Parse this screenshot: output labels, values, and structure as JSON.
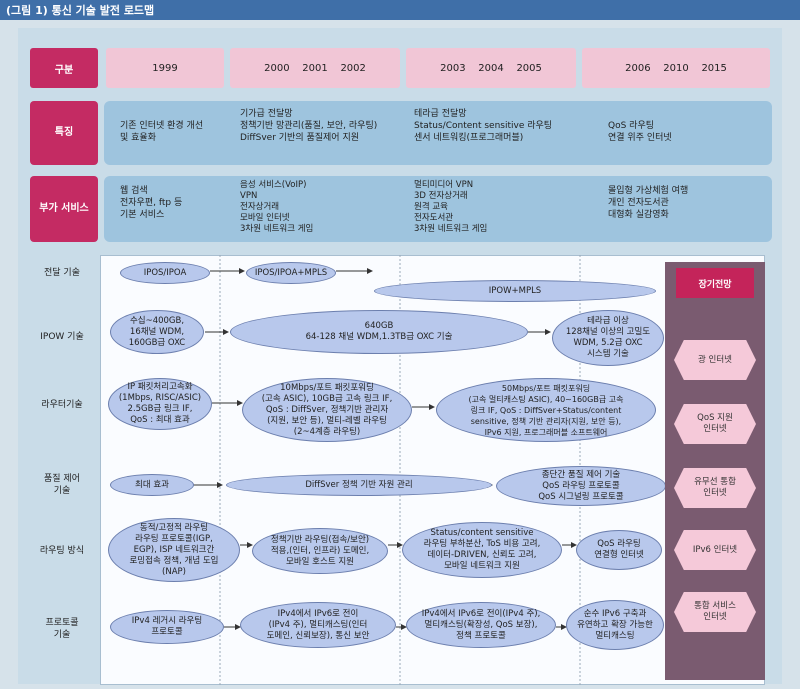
{
  "title": "(그림 1) 통신 기술 발전 로드맵",
  "header": {
    "label": "구분",
    "years": [
      {
        "text": "1999"
      },
      {
        "text": "2000    2001    2002"
      },
      {
        "text": "2003    2004    2005"
      },
      {
        "text": "2006    2010    2015"
      }
    ]
  },
  "rows": {
    "features": {
      "label": "특징",
      "cols": [
        "기존 인터넷 환경 개선\n및 효율화",
        "기가급 전달망\n정책기반 망관리(품질, 보안, 라우팅)\nDiffSver 기반의 품질제어 지원",
        "테라급 전달망\nStatus/Content sensitive 라우팅\n센서 네트워킹(프로그래머블)",
        "QoS 라우팅\n연결 위주 인터넷"
      ]
    },
    "services": {
      "label": "부가 서비스",
      "cols": [
        "웹 검색\n전자우편, ftp 등\n기본 서비스",
        "음성 서비스(VoIP)\nVPN\n전자상거래\n모바일 인터넷\n3차원 네트워크 게임",
        "멀티미디어 VPN\n3D 전자상거래\n원격 교육\n전자도서관\n3차원 네트워크 게임",
        "몰입형 가상체험 여행\n개인 전자도서관\n대형화 실감영화"
      ]
    }
  },
  "tech_rows": [
    {
      "label": "전달 기술"
    },
    {
      "label": "IPOW 기술"
    },
    {
      "label": "라우터기술"
    },
    {
      "label": "품질 제어\n기술"
    },
    {
      "label": "라우팅 방식"
    },
    {
      "label": "프로토콜\n기술"
    }
  ],
  "ellipses": {
    "e_ipos": "IPOS/IPOA",
    "e_mpls": "IPOS/IPOA+MPLS",
    "e_ipow": "IPOW+MPLS",
    "e_ipow1": "수십~400GB,\n16채널 WDM,\n160GB급 OXC",
    "e_ipow2": "640GB\n64-128 채널 WDM,1.3TB급 OXC 기술",
    "e_ipow3": "테라급 이상\n128채널 이상의 고밀도\nWDM, 5.2급 OXC\n시스템 기술",
    "e_rt1": "IP 패킷처리고속화\n(1Mbps, RISC/ASIC)\n2.5GB급 링크 IF,\nQoS : 최대 효과",
    "e_rt2": "10Mbps/포트 패킷포워딩\n(고속 ASIC), 10GB급 고속 링크 IF,\nQoS : DiffSver, 정책기반 관리자\n(지원, 보안 등), 멀티-레벨 라우팅\n(2~4계층 라우팅)",
    "e_rt3": "50Mbps/포트 패킷포워딩\n(고속 멀티캐스팅 ASIC), 40~160GB급 고속\n링크 IF, QoS : DiffSver+Status/content\nsensitive, 정책 기반 관리자(지원, 보안 등),\nIPv6 지원, 프로그래머블 소프트웨어",
    "e_q1": "최대 효과",
    "e_q2": "DiffSver 정책 기반 자원 관리",
    "e_q3": "종단간 품질 제어 기술\nQoS 라우팅 프로토콜\nQoS 시그널링 프로토콜",
    "e_r1": "동적/고정적 라우팅\n라우팅 프로토콜(IGP,\nEGP), ISP 네트워크간\n로밍접속 정책, 개념 도입\n(NAP)",
    "e_r2": "정책기반 라우팅(접속/보안)\n적용,(인터, 인프라) 도메인,\n모바일 호스트 지원",
    "e_r3": "Status/content sensitive\n라우팅 부하분산, ToS 비용 고려,\n데이터-DRIVEN, 신뢰도 고려,\n모바일 네트워크 지원",
    "e_r4": "QoS 라우팅\n연결형 인터넷",
    "e_p1": "IPv4 레거시 라우팅\n프로토콜",
    "e_p2": "IPv4에서 IPv6로 전이\n(IPv4 주), 멀티캐스팅(인터\n도메인, 신뢰보장), 통신 보안",
    "e_p3": "IPv4에서 IPv6로 전이(IPv4 주),\n멀티캐스팅(확장성, QoS 보장),\n정책 프로토콜",
    "e_p4": "순수 IPv6 구축과\n유연하고 확장 가능한\n멀티캐스팅"
  },
  "outlook": {
    "header": "장기전망",
    "items": [
      "광 인터넷",
      "QoS 지원\n인터넷",
      "유무선 통합\n인터넷",
      "IPv6 인터넷",
      "통합 서비스\n인터넷"
    ]
  },
  "colors": {
    "accent": "#c42b63",
    "band": "#9ec4de",
    "ellipse": "#b8c8ec",
    "header_pink": "#f1c6d6"
  }
}
